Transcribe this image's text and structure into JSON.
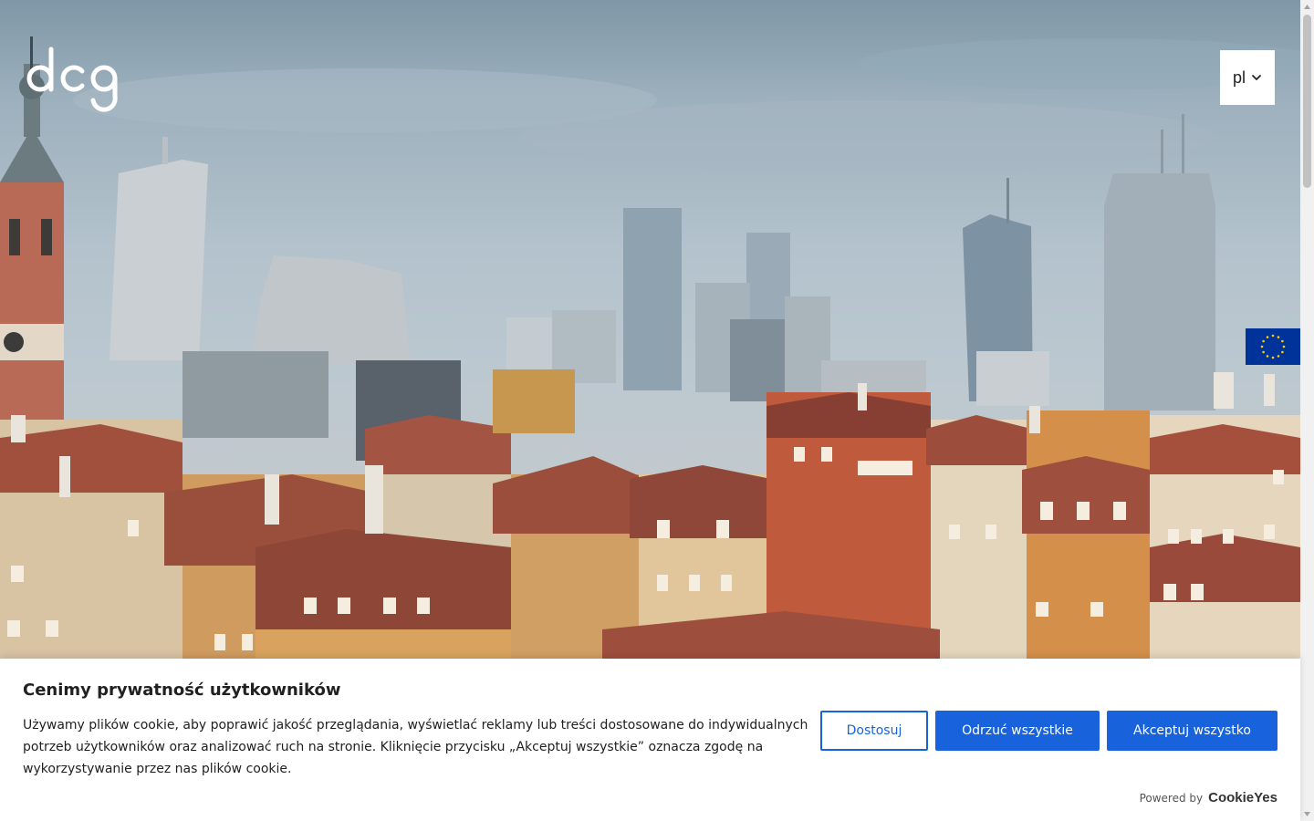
{
  "logo": {
    "text": "dcg"
  },
  "language": {
    "selected": "pl"
  },
  "cookie_banner": {
    "title": "Cenimy prywatność użytkowników",
    "body": "Używamy plików cookie, aby poprawić jakość przeglądania, wyświetlać reklamy lub treści dostosowane do indywidualnych potrzeb użytkowników oraz analizować ruch na stronie. Kliknięcie przycisku „Akceptuj wszystkie” oznacza zgodę na wykorzystywanie przez nas plików cookie.",
    "customize_label": "Dostosuj",
    "reject_label": "Odrzuć wszystkie",
    "accept_label": "Akceptuj wszystko",
    "powered_by_label": "Powered by",
    "powered_by_brand": "CookieYes"
  },
  "colors": {
    "accent": "#1863dc",
    "eu_blue": "#003399",
    "eu_gold": "#ffcc00",
    "roof": "#9a4f3d"
  },
  "icons": {
    "language_chevron": "chevron-down-icon",
    "eu_flag": "eu-flag-icon"
  }
}
